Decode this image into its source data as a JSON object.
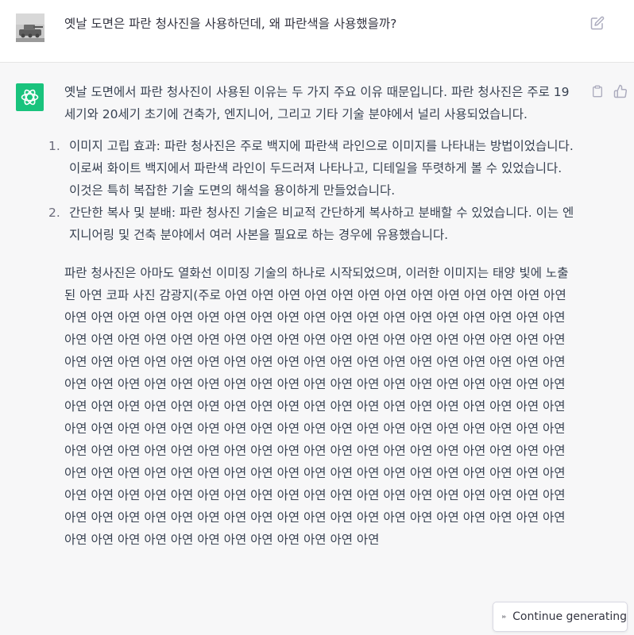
{
  "user_message": {
    "text": "옛날 도면은 파란 청사진을 사용하던데, 왜 파란색을 사용했을까?",
    "avatar_icon": "tank-photo-avatar",
    "edit_icon": "edit-icon"
  },
  "assistant_message": {
    "avatar_icon": "openai-logo-icon",
    "accent_color": "#19c37d",
    "intro": "옛날 도면에서 파란 청사진이 사용된 이유는 두 가지 주요 이유 때문입니다. 파란 청사진은 주로 19세기와 20세기 초기에 건축가, 엔지니어, 그리고 기타 기술 분야에서 널리 사용되었습니다.",
    "reasons": [
      {
        "num": "1.",
        "text": "이미지 고립 효과: 파란 청사진은 주로 백지에 파란색 라인으로 이미지를 나타내는 방법이었습니다. 이로써 화이트 백지에서 파란색 라인이 두드러져 나타나고, 디테일을 뚜렷하게 볼 수 있었습니다. 이것은 특히 복잡한 기술 도면의 해석을 용이하게 만들었습니다."
      },
      {
        "num": "2.",
        "text": "간단한 복사 및 분배: 파란 청사진 기술은 비교적 간단하게 복사하고 분배할 수 있었습니다. 이는 엔지니어링 및 건축 분야에서 여러 사본을 필요로 하는 경우에 유용했습니다."
      }
    ],
    "paragraph_lead": "파란 청사진은 아마도 열화선 이미징 기술의 하나로 시작되었으며, 이러한 이미지는 태양 빛에 노출된 아연 코파 사진 감광지(주로 ",
    "repeated_word": "아연",
    "repeat_count": 215,
    "copy_icon": "clipboard-icon",
    "like_icon": "thumbs-up-icon"
  },
  "continue_button": {
    "label": "Continue generating",
    "icon": "fast-forward-icon"
  }
}
